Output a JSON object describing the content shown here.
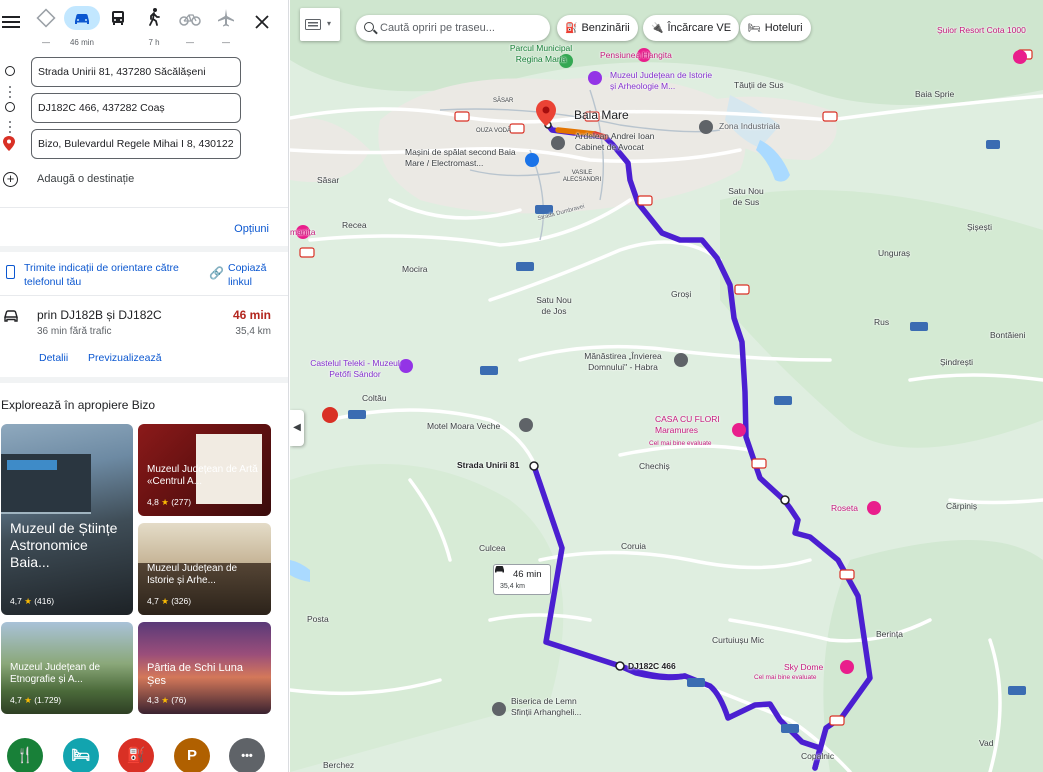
{
  "travel_modes": [
    {
      "name": "best",
      "label": "—"
    },
    {
      "name": "driving",
      "label": "46 min"
    },
    {
      "name": "transit",
      "label": ""
    },
    {
      "name": "walking",
      "label": "7 h"
    },
    {
      "name": "cycling",
      "label": "—"
    },
    {
      "name": "flight",
      "label": "—"
    }
  ],
  "waypoints": [
    {
      "value": "Strada Unirii 81, 437280 Săcălășeni"
    },
    {
      "value": "DJ182C 466, 437282 Coaș"
    },
    {
      "value": "Bizo, Bulevardul Regele Mihai I 8, 430122"
    }
  ],
  "add_destination_label": "Adaugă o destinație",
  "options_label": "Opțiuni",
  "send_directions_label": "Trimite indicații de orientare către telefonul tău",
  "copy_link_label": "Copiază linkul",
  "route": {
    "via": "prin DJ182B și DJ182C",
    "traffic_note": "36 min fără trafic",
    "time": "46 min",
    "distance": "35,4 km",
    "details_label": "Detalii",
    "preview_label": "Previzualizează"
  },
  "explore": {
    "title": "Explorează în apropiere Bizo",
    "cards": [
      {
        "title": "Muzeul de Științe Astronomice Baia...",
        "rating": "4,7",
        "count": "(416)"
      },
      {
        "title": "Muzeul Județean de Artă «Centrul A...",
        "rating": "4,8",
        "count": "(277)"
      },
      {
        "title": "Muzeul Județean de Istorie și Arhe...",
        "rating": "4,7",
        "count": "(326)"
      },
      {
        "title": "Muzeul Județean de Etnografie și A...",
        "rating": "4,7",
        "count": "(1.729)"
      },
      {
        "title": "Pârtia de Schi Luna Șes",
        "rating": "4,3",
        "count": "(76)"
      }
    ]
  },
  "category_buttons": [
    {
      "name": "restaurants",
      "glyph": "🍴",
      "color": "#188038"
    },
    {
      "name": "hotels",
      "glyph": "🛏",
      "color": "#12a4af"
    },
    {
      "name": "gas",
      "glyph": "⛽",
      "color": "#d93025"
    },
    {
      "name": "parking",
      "glyph": "P",
      "color": "#b06000"
    },
    {
      "name": "more",
      "glyph": "•••",
      "color": "#5f6368"
    }
  ],
  "map": {
    "search_placeholder": "Caută opriri pe traseu...",
    "chips": [
      "Benzinării",
      "Încărcare VE",
      "Hoteluri"
    ],
    "route_color": "#5b2de6",
    "callout_time": "46 min",
    "callout_distance": "35,4 km",
    "labels": {
      "baia_mare": "Baia Mare",
      "tautii": "Tăuții de Sus",
      "baia_sprie": "Baia Sprie",
      "zona_ind": "Zona Industriala",
      "sasar": "Săsar",
      "sasar_small": "SĂSAR",
      "ouza": "OUZA VODĂ",
      "recea": "Recea",
      "mocira": "Mocira",
      "satu_nou_sus": "Satu Nou de Sus",
      "satu_nou_jos": "Satu Nou de Jos",
      "grosi": "Groși",
      "unguras": "Unguraș",
      "sisesti": "Șișești",
      "rus": "Rus",
      "bontaieni": "Bontăieni",
      "sindresti": "Șindrești",
      "coltau": "Coltău",
      "chechis": "Chechiș",
      "carpinis": "Cărpiniș",
      "culcea": "Culcea",
      "coruia": "Coruia",
      "posta": "Posta",
      "curtuiusu": "Curtuiușu Mic",
      "berinta": "Berința",
      "copalnic": "Copalnic",
      "vad": "Vad",
      "berchez": "Berchez",
      "vasile": "VASILE ALECSANDRI",
      "parc": "Parcul Municipal Regina Maria",
      "pensiunea": "Pensiunea Hangita",
      "muzeul_ist": "Muzeul Județean de Istorie și Arheologie M...",
      "ardelean": "Ardelean Andrei Ioan Cabinet de Avocat",
      "masini": "Mașini de spălat second Baia Mare / Electromast...",
      "manastirea": "Mănăstirea „Învierea Domnului\" - Habra",
      "castelul": "Castelul Teleki - Muzeul Petőfi Sándor",
      "motel": "Motel Moara Veche",
      "casa": "CASA CU FLORI Maramures",
      "casa_sub": "Cel mai bine evaluate",
      "roseta": "Roseta",
      "sky_dome": "Sky Dome",
      "sky_sub": "Cel mai bine evaluate",
      "biserica": "Biserica de Lemn Sfinții Arhangheli...",
      "strada_unirii": "Strada Unirii 81",
      "dj182c": "DJ182C 466",
      "suior": "Șuior Resort Cota 1000",
      "manita": "manița",
      "strada_dumbravei": "Strada Dumbravei"
    }
  }
}
